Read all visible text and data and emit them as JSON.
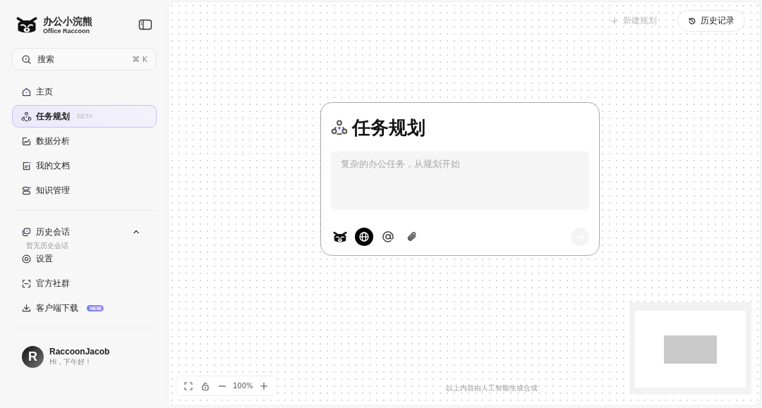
{
  "brand": {
    "title": "办公小浣熊",
    "subtitle": "Office Raccoon"
  },
  "search": {
    "placeholder": "搜索",
    "shortcut": "⌘ K"
  },
  "nav": [
    {
      "label": "主页",
      "selected": false
    },
    {
      "label": "任务规划",
      "selected": true,
      "badge": "BETA"
    },
    {
      "label": "数据分析",
      "selected": false
    },
    {
      "label": "我的文档",
      "selected": false
    },
    {
      "label": "知识管理",
      "selected": false
    }
  ],
  "history": {
    "title": "历史会话",
    "expanded": true,
    "empty_text": "暂无历史会话"
  },
  "more": [
    {
      "label": "设置"
    },
    {
      "label": "官方社群"
    },
    {
      "label": "客户端下载",
      "badge": "NEW"
    }
  ],
  "user": {
    "avatar_letter": "R",
    "name": "RaccoonJacob",
    "greeting": "Hi，下午好！"
  },
  "toolbar": {
    "new_plan": {
      "label": "新建规划",
      "disabled": true
    },
    "history_button": "历史记录"
  },
  "card": {
    "title": "任务规划",
    "placeholder": "复杂的办公任务，从规划开始",
    "tools": [
      {
        "kind": "raccoon",
        "selected": false
      },
      {
        "kind": "web",
        "selected": true
      },
      {
        "kind": "mention",
        "selected": false
      },
      {
        "kind": "attach",
        "selected": false
      }
    ],
    "send_disabled": true
  },
  "zoom": {
    "value": "100%"
  },
  "footer_note": "以上内容由人工智能生成合成"
}
